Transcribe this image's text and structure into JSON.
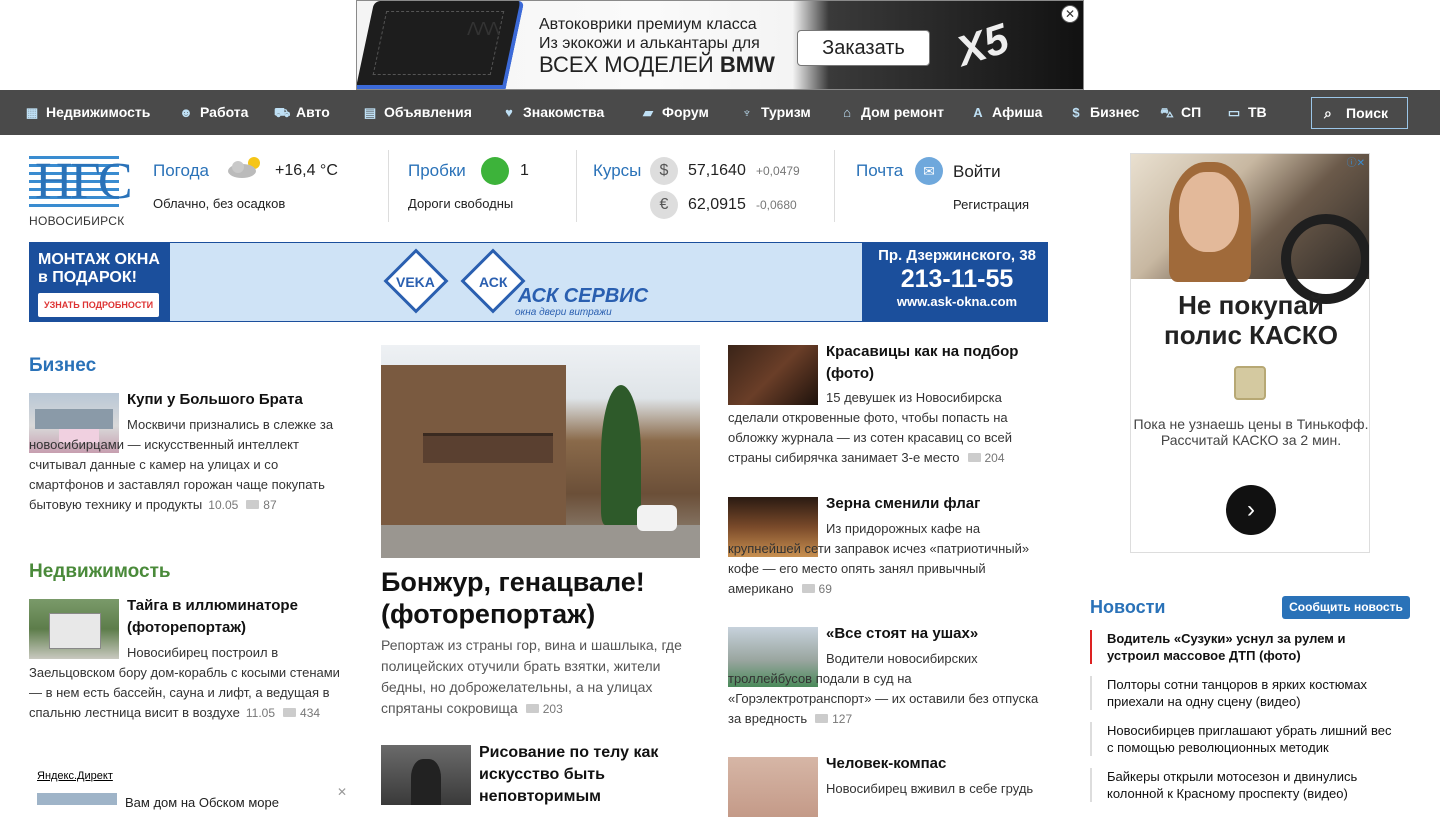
{
  "top_ad": {
    "logo": "ᐱᐱᐱ",
    "line1": "Автоковрики премиум класса",
    "line2": "Из экокожи и алькантары для",
    "line3": "ВСЕХ МОДЕЛЕЙ",
    "line3_brand": "BMW",
    "button": "Заказать",
    "model": "X5",
    "close": "✕"
  },
  "nav": {
    "items": [
      {
        "label": "Недвижимость",
        "icon": "building-icon",
        "glyph": "▦"
      },
      {
        "label": "Работа",
        "icon": "worker-icon",
        "glyph": "☻"
      },
      {
        "label": "Авто",
        "icon": "car-icon",
        "glyph": "⛟"
      },
      {
        "label": "Объявления",
        "icon": "newspaper-icon",
        "glyph": "▤"
      },
      {
        "label": "Знакомства",
        "icon": "heart-icon",
        "glyph": "♥"
      },
      {
        "label": "Форум",
        "icon": "chat-icon",
        "glyph": "▰"
      },
      {
        "label": "Туризм",
        "icon": "palm-icon",
        "glyph": "♆"
      },
      {
        "label": "Дом ремонт",
        "icon": "house-icon",
        "glyph": "⌂"
      },
      {
        "label": "Афиша",
        "icon": "afisha-icon",
        "glyph": "A"
      },
      {
        "label": "Бизнес",
        "icon": "coin-icon",
        "glyph": "$"
      },
      {
        "label": "СП",
        "icon": "cart-icon",
        "glyph": "⛍"
      },
      {
        "label": "ТВ",
        "icon": "tv-icon",
        "glyph": "▭"
      }
    ],
    "search_label": "Поиск"
  },
  "header": {
    "logo": "НГС",
    "city": "НОВОСИБИРСК",
    "weather": {
      "label": "Погода",
      "temp": "+16,4 °C",
      "desc": "Облачно, без осадков"
    },
    "traffic": {
      "label": "Пробки",
      "level": "1",
      "desc": "Дороги свободны"
    },
    "rates": {
      "label": "Курсы",
      "usd": {
        "symbol": "$",
        "value": "57,1640",
        "delta": "+0,0479"
      },
      "eur": {
        "symbol": "€",
        "value": "62,0915",
        "delta": "-0,0680"
      }
    },
    "mail": {
      "label": "Почта",
      "login": "Войти",
      "register": "Регистрация"
    }
  },
  "wide_ad": {
    "left1": "МОНТАЖ ОКНА",
    "left2": "в ПОДАРОК!",
    "more": "УЗНАТЬ ПОДРОБНОСТИ",
    "veka": "VEKA",
    "ask": "АСК",
    "brand": "АСК СЕРВИС",
    "brand_sub": "окна двери витражи",
    "address": "Пр. Дзержинского, 38",
    "phone": "213-11-55",
    "site": "www.ask-okna.com"
  },
  "side_ad": {
    "headline1": "Не покупай",
    "headline2": "полис КАСКО",
    "text": "Пока не узнаешь цены в Тинькофф. Рассчитай КАСКО за 2 мин.",
    "badge": "ⓘ✕",
    "arrow": "›"
  },
  "business": {
    "title": "Бизнес",
    "color": "#2a72b8",
    "headline": "Купи у Большого Брата",
    "text": "Москвичи признались в слежке за новосибирцами — искусственный интеллект считывал данные с камер на улицах и со смартфонов и заставлял горожан чаще покупать бытовую технику и продукты",
    "date": "10.05",
    "comments": "87"
  },
  "realty": {
    "title": "Недвижимость",
    "color": "#4a8a3a",
    "headline": "Тайга в иллюминаторе (фоторепортаж)",
    "text": "Новосибирец построил в Заельцовском бору дом-корабль с косыми стенами — в нем есть бассейн, сауна и лифт, а ведущая в спальню лестница висит в воздухе",
    "date": "11.05",
    "comments": "434"
  },
  "direct": {
    "label": "Яндекс.Директ",
    "text": "Вам дом на Обском море"
  },
  "main_story": {
    "headline": "Бонжур, генацвале! (фоторепортаж)",
    "text": "Репортаж из страны гор, вина и шашлыка, где полицейских отучили брать взятки, жители бедны, но доброжелательны, а на улицах спрятаны сокровища",
    "comments": "203"
  },
  "second_story": {
    "headline": "Рисование по телу как искусство быть неповторимым"
  },
  "right_stories": [
    {
      "headline": "Красавицы как на подбор (фото)",
      "text": "15 девушек из Новосибирска сделали откровенные фото, чтобы попасть на обложку журнала — из сотен красавиц со всей страны сибирячка занимает 3-е место",
      "comments": "204"
    },
    {
      "headline": "Зерна сменили флаг",
      "text": "Из придорожных кафе на крупнейшей сети заправок исчез «патриотичный» кофе — его место опять занял привычный американо",
      "comments": "69"
    },
    {
      "headline": "«Все стоят на ушах»",
      "text": "Водители новосибирских троллейбусов подали в суд на «Горэлектротранспорт» — их оставили без отпуска за вредность",
      "comments": "127"
    },
    {
      "headline": "Человек-компас",
      "text": "Новосибирец вживил в себе грудь"
    }
  ],
  "news": {
    "title": "Новости",
    "report_button": "Сообщить новость",
    "items": [
      "Водитель «Сузуки» уснул за рулем и устроил массовое ДТП (фото)",
      "Полторы сотни танцоров в ярких костюмах приехали на одну сцену (видео)",
      "Новосибирцев приглашают убрать лишний вес с помощью революционных методик",
      "Байкеры открыли мотосезон и двинулись колонной к Красному проспекту (видео)"
    ]
  }
}
